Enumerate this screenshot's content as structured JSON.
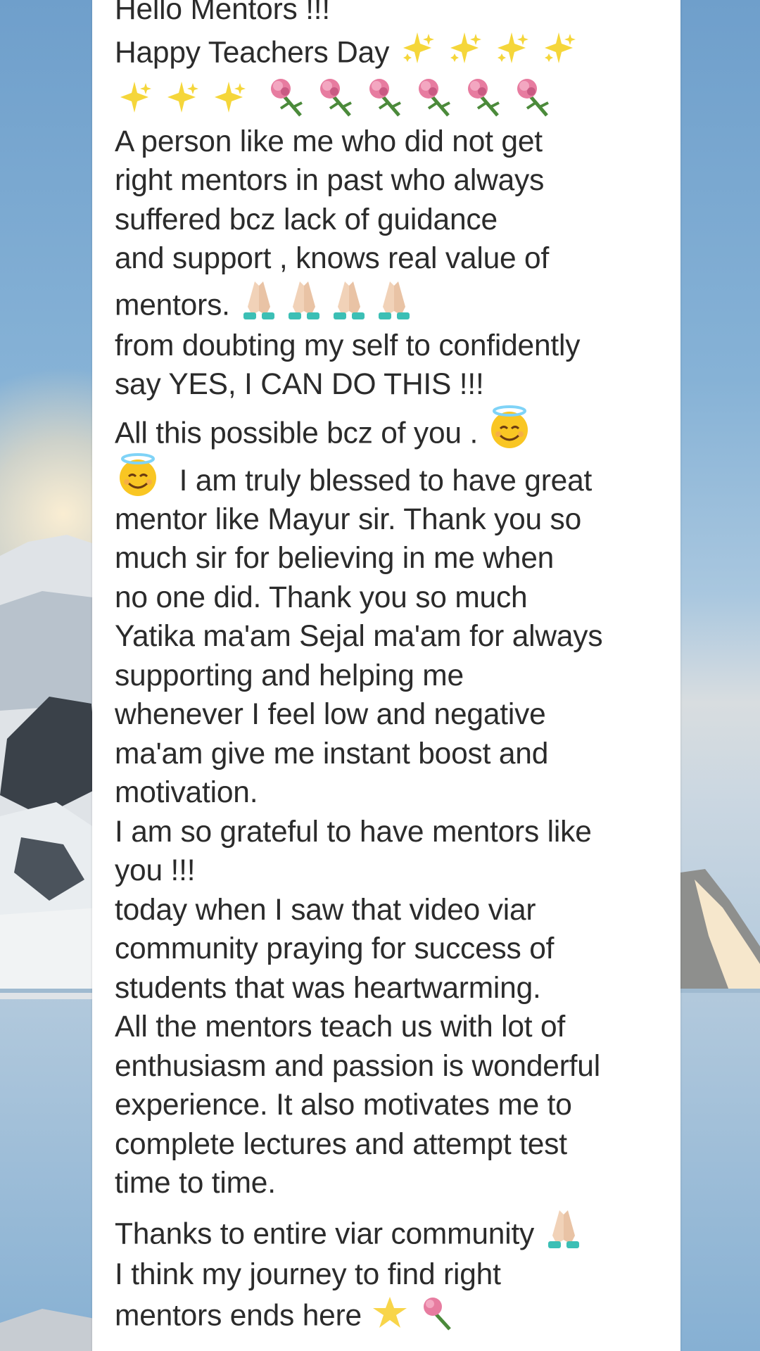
{
  "message": {
    "lines": [
      "Hello Mentors !!!",
      "Happy Teachers Day",
      "",
      "A person like me who did not get",
      "right mentors in past who always",
      "suffered bcz lack of guidance",
      "and support , knows real value of",
      "mentors.",
      "from doubting my self to confidently",
      "say YES, I CAN DO THIS !!!",
      "All this possible bcz of you .",
      "I am truly blessed to have great",
      "mentor like Mayur sir. Thank you so",
      "much sir for believing in me when",
      "no one did. Thank you so much",
      "Yatika ma'am Sejal ma'am for always",
      "supporting and helping me",
      "whenever I feel low and negative",
      "ma'am give me instant boost and",
      "motivation.",
      "I am so grateful to have mentors like",
      "you !!!",
      "today when I saw that video viar",
      "community praying for success of",
      "students that was heartwarming.",
      "All the mentors teach us with lot of",
      "enthusiasm and passion is wonderful",
      "experience. It also motivates me to",
      "complete lectures and attempt test",
      "time to time.",
      "Thanks to entire viar community",
      "I think my journey to find  right",
      "mentors ends here"
    ]
  },
  "icons": {
    "sparkles": "sparkles-icon",
    "flower": "rose-bouquet-icon",
    "pray": "folded-hands-icon",
    "smile": "smiling-face-with-halo-icon",
    "star": "glowing-star-icon"
  }
}
